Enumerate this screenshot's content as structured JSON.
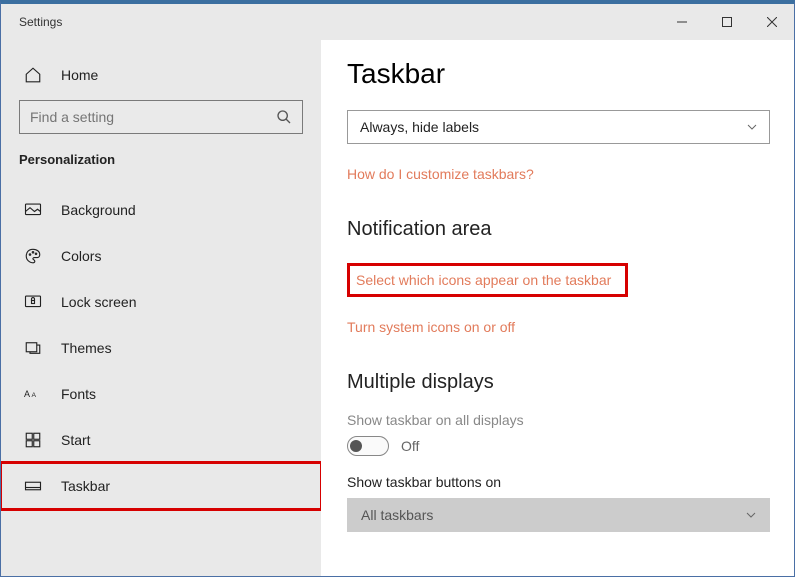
{
  "titlebar": {
    "title": "Settings"
  },
  "sidebar": {
    "home": "Home",
    "search_placeholder": "Find a setting",
    "category": "Personalization",
    "items": [
      {
        "label": "Background"
      },
      {
        "label": "Colors"
      },
      {
        "label": "Lock screen"
      },
      {
        "label": "Themes"
      },
      {
        "label": "Fonts"
      },
      {
        "label": "Start"
      },
      {
        "label": "Taskbar"
      }
    ]
  },
  "main": {
    "title": "Taskbar",
    "combine_dropdown": "Always, hide labels",
    "customize_link": "How do I customize taskbars?",
    "notification": {
      "title": "Notification area",
      "select_icons": "Select which icons appear on the taskbar",
      "system_icons": "Turn system icons on or off"
    },
    "multiple": {
      "title": "Multiple displays",
      "show_all_label": "Show taskbar on all displays",
      "toggle_state": "Off",
      "show_buttons_label": "Show taskbar buttons on",
      "show_buttons_value": "All taskbars"
    }
  }
}
